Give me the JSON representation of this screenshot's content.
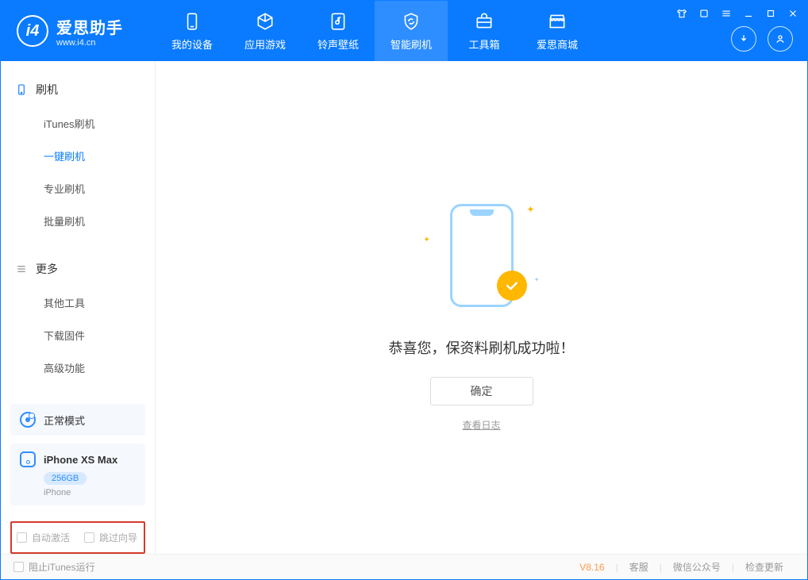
{
  "app": {
    "title": "爱思助手",
    "subtitle": "www.i4.cn"
  },
  "nav": {
    "tabs": [
      {
        "label": "我的设备"
      },
      {
        "label": "应用游戏"
      },
      {
        "label": "铃声壁纸"
      },
      {
        "label": "智能刷机"
      },
      {
        "label": "工具箱"
      },
      {
        "label": "爱思商城"
      }
    ]
  },
  "sidebar": {
    "section1": {
      "title": "刷机",
      "items": [
        {
          "label": "iTunes刷机"
        },
        {
          "label": "一键刷机"
        },
        {
          "label": "专业刷机"
        },
        {
          "label": "批量刷机"
        }
      ]
    },
    "section2": {
      "title": "更多",
      "items": [
        {
          "label": "其他工具"
        },
        {
          "label": "下载固件"
        },
        {
          "label": "高级功能"
        }
      ]
    },
    "mode": {
      "label": "正常模式"
    },
    "device": {
      "name": "iPhone XS Max",
      "capacity": "256GB",
      "type": "iPhone"
    },
    "options": {
      "auto_activate": "自动激活",
      "skip_guide": "跳过向导"
    }
  },
  "main": {
    "success_text": "恭喜您，保资料刷机成功啦！",
    "ok_button": "确定",
    "view_log": "查看日志"
  },
  "status": {
    "block_itunes": "阻止iTunes运行",
    "version": "V8.16",
    "links": {
      "support": "客服",
      "wechat": "微信公众号",
      "update": "检查更新"
    }
  }
}
